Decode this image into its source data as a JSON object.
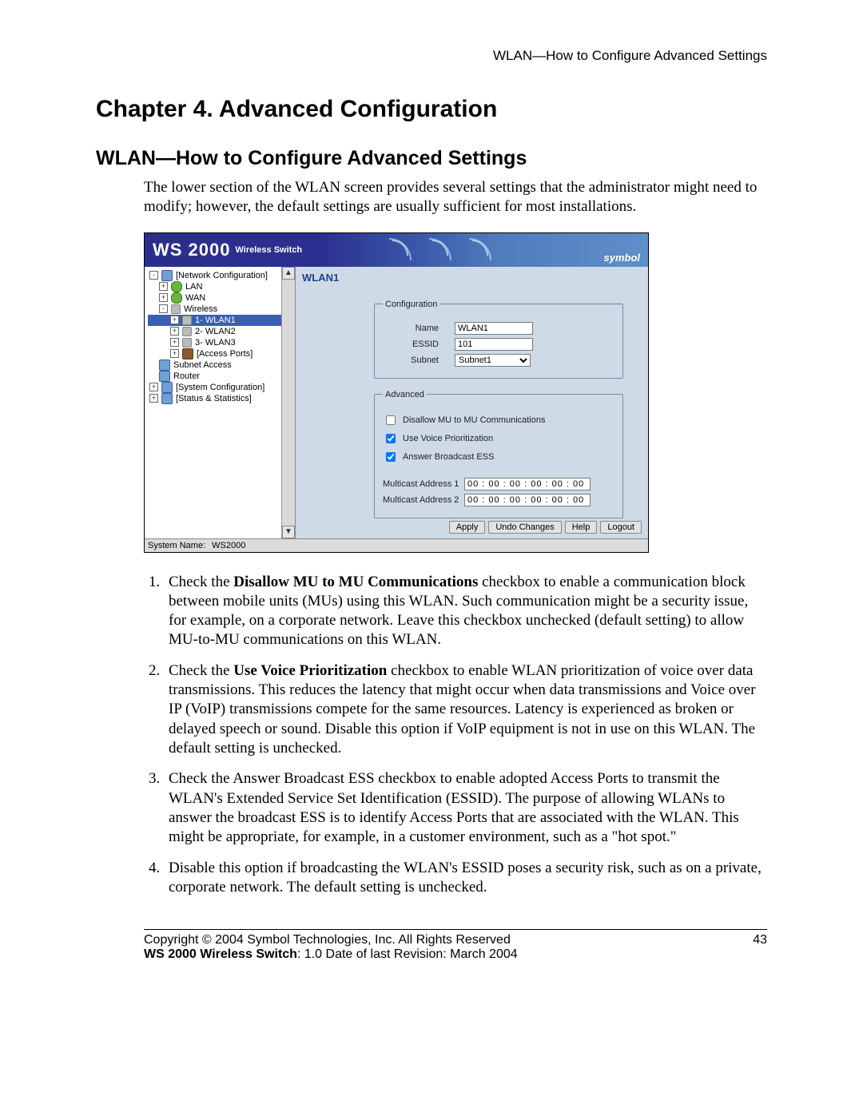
{
  "running_head": "WLAN—How to Configure Advanced Settings",
  "chapter_title": "Chapter 4.   Advanced Configuration",
  "section_title": "WLAN—How to Configure Advanced Settings",
  "intro": "The lower section of the WLAN screen provides several settings that the administrator might need to modify; however, the default settings are usually sufficient for most installations.",
  "screenshot": {
    "banner": {
      "product": "WS 2000",
      "product_sub": "Wireless Switch",
      "brand": "symbol"
    },
    "tree": {
      "root": "[Network Configuration]",
      "items": [
        {
          "indent": 1,
          "toggle": "+",
          "icon": "green",
          "label": "LAN"
        },
        {
          "indent": 1,
          "toggle": "+",
          "icon": "green",
          "label": "WAN"
        },
        {
          "indent": 1,
          "toggle": "-",
          "icon": "ant",
          "label": "Wireless"
        },
        {
          "indent": 2,
          "toggle": "+",
          "icon": "ant",
          "label": "1- WLAN1",
          "selected": true
        },
        {
          "indent": 2,
          "toggle": "+",
          "icon": "ant",
          "label": "2- WLAN2"
        },
        {
          "indent": 2,
          "toggle": "+",
          "icon": "ant",
          "label": "3- WLAN3"
        },
        {
          "indent": 2,
          "toggle": "+",
          "icon": "brown",
          "label": "[Access Ports]"
        },
        {
          "indent": 1,
          "toggle": "",
          "icon": "blue",
          "label": "Subnet Access"
        },
        {
          "indent": 1,
          "toggle": "",
          "icon": "blue",
          "label": "Router"
        }
      ],
      "sys_conf": "[System Configuration]",
      "stats": "[Status & Statistics]"
    },
    "main_title": "WLAN1",
    "groups": {
      "config_legend": "Configuration",
      "advanced_legend": "Advanced"
    },
    "config": {
      "name_label": "Name",
      "name_value": "WLAN1",
      "essid_label": "ESSID",
      "essid_value": "101",
      "subnet_label": "Subnet",
      "subnet_value": "Subnet1"
    },
    "advanced": {
      "disallow_label": "Disallow MU to MU Communications",
      "disallow_checked": false,
      "voice_label": "Use Voice Prioritization",
      "voice_checked": true,
      "ess_label": "Answer Broadcast ESS",
      "ess_checked": true,
      "mcast1_label": "Multicast Address 1",
      "mcast1_value": "00 : 00 : 00 : 00 : 00 : 00",
      "mcast2_label": "Multicast Address 2",
      "mcast2_value": "00 : 00 : 00 : 00 : 00 : 00"
    },
    "buttons": {
      "apply": "Apply",
      "undo": "Undo Changes",
      "help": "Help",
      "logout": "Logout"
    },
    "status": {
      "label": "System Name:",
      "value": "WS2000"
    }
  },
  "list": {
    "i1_pre": "Check the ",
    "i1_bold": "Disallow MU to MU Communications",
    "i1_post": " checkbox to enable a communication block between mobile units (MUs) using this WLAN. Such communication might be a security issue, for example, on a corporate network. Leave this checkbox unchecked (default setting) to allow MU-to-MU communications on this WLAN.",
    "i2_pre": "Check the ",
    "i2_bold": "Use Voice Prioritization",
    "i2_post": " checkbox to enable WLAN prioritization of voice over data transmissions. This reduces the latency that might occur when data transmissions and Voice over IP (VoIP) transmissions compete for the same resources. Latency is experienced as broken or delayed speech or sound. Disable this option if VoIP equipment is not in use on this WLAN. The default setting is unchecked.",
    "i3": "Check the Answer Broadcast ESS checkbox to enable adopted Access Ports to transmit the WLAN's Extended Service Set Identification (ESSID). The purpose of allowing WLANs to answer the broadcast ESS is to identify Access Ports that are associated with the WLAN. This might be appropriate, for example, in a customer environment, such as a \"hot spot.\"",
    "i4": "Disable this option if broadcasting the WLAN's ESSID poses a security risk, such as on a private, corporate network. The default setting is unchecked."
  },
  "footer": {
    "copyright": "Copyright © 2004 Symbol Technologies, Inc. All Rights Reserved",
    "page": "43",
    "line2_bold": "WS 2000 Wireless Switch",
    "line2_rest": ": 1.0  Date of last Revision: March 2004"
  }
}
